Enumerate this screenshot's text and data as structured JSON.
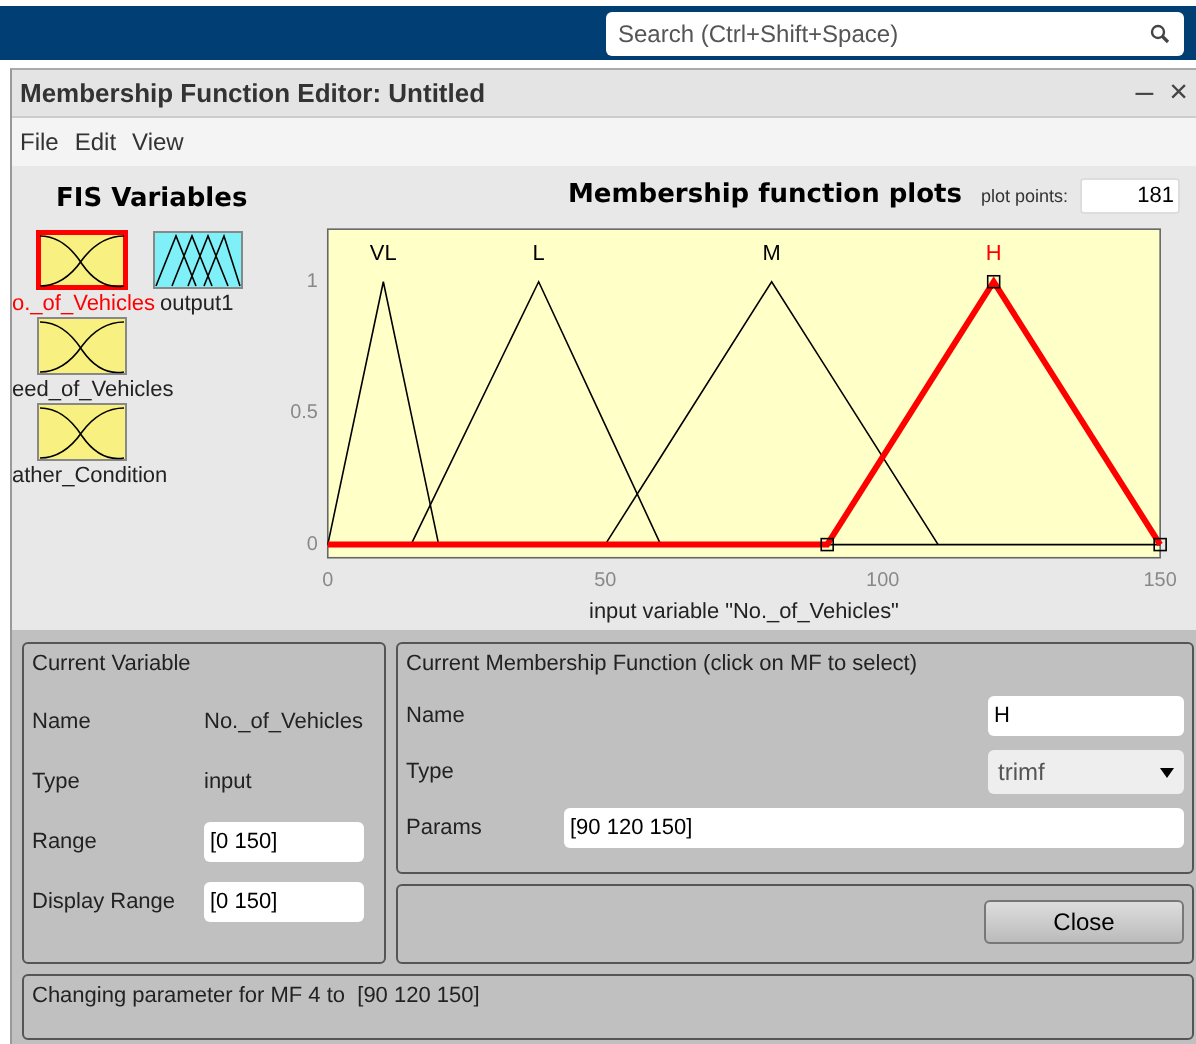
{
  "top_bar": {
    "search": {
      "placeholder": "Search (Ctrl+Shift+Space)"
    }
  },
  "window": {
    "title": "Membership Function Editor: Untitled",
    "controls": [
      "–",
      "×"
    ]
  },
  "menu": [
    "File",
    "Edit",
    "View"
  ],
  "fis_variables": {
    "title": "FIS Variables",
    "items": [
      {
        "label": "o._of_Vehicles",
        "kind": "input",
        "selected": true
      },
      {
        "label": "output1",
        "kind": "output",
        "selected": false
      },
      {
        "label": "eed_of_Vehicles",
        "kind": "input",
        "selected": false
      },
      {
        "label": "ather_Condition",
        "kind": "input",
        "selected": false
      }
    ]
  },
  "plot": {
    "plot_points_label": "plot points:",
    "plot_points": "181",
    "chart_data": {
      "type": "line",
      "title": "Membership function plots",
      "xlabel": "input variable \"No._of_Vehicles\"",
      "x": [
        0,
        10,
        15,
        20,
        38,
        50,
        60,
        80,
        90,
        110,
        120,
        150
      ],
      "series": [
        {
          "name": "VL",
          "color": "#000000",
          "values": [
            0,
            1,
            0.5,
            0,
            null,
            null,
            null,
            null,
            null,
            null,
            null,
            null
          ]
        },
        {
          "name": "L",
          "color": "#000000",
          "values": [
            null,
            null,
            0,
            0.217,
            1,
            0.455,
            0,
            null,
            null,
            null,
            null,
            null
          ]
        },
        {
          "name": "M",
          "color": "#000000",
          "values": [
            null,
            null,
            null,
            null,
            null,
            0,
            0.333,
            1,
            0.667,
            0,
            null,
            null
          ]
        },
        {
          "name": "H",
          "color": "#ff0000",
          "values": [
            0,
            0,
            0,
            0,
            0,
            0,
            0,
            0,
            0,
            0.667,
            1,
            0
          ]
        }
      ],
      "xlim": [
        0,
        150
      ],
      "ylim": [
        -0.05,
        1.2
      ],
      "xticks": [
        0,
        50,
        100,
        150
      ],
      "yticks": [
        0,
        0.5,
        1
      ]
    },
    "mf_states": [
      {
        "selected": false
      },
      {
        "selected": false
      },
      {
        "selected": false
      },
      {
        "selected": true
      }
    ]
  },
  "current_variable": {
    "title": "Current Variable",
    "rows": [
      {
        "label": "Name",
        "value": "No._of_Vehicles",
        "kind": "text"
      },
      {
        "label": "Type",
        "value": "input",
        "kind": "text"
      },
      {
        "label": "Range",
        "value": "[0 150]",
        "kind": "field"
      },
      {
        "label": "Display Range",
        "value": "[0 150]",
        "kind": "field"
      }
    ]
  },
  "current_mf": {
    "title": "Current Membership Function (click on MF to select)",
    "name_label": "Name",
    "name": "H",
    "type_label": "Type",
    "type": "trimf",
    "params_label": "Params",
    "params": "[90 120 150]"
  },
  "close_button": "Close",
  "status": "Changing parameter for MF 4 to  [90 120 150]"
}
